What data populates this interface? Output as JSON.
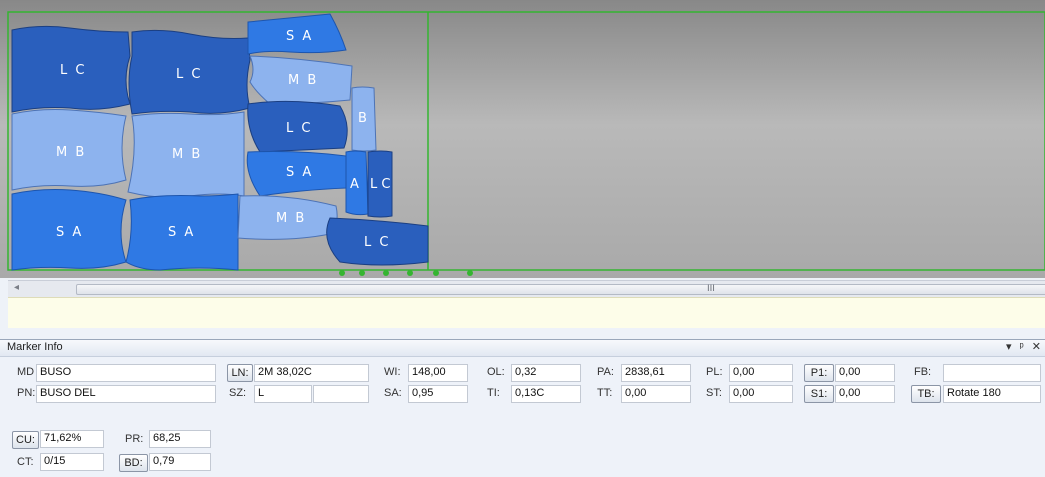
{
  "canvas": {
    "pieces": [
      {
        "label": "L C",
        "color": "#2a5fbd"
      },
      {
        "label": "L C",
        "color": "#2a5fbd"
      },
      {
        "label": "M B",
        "color": "#8db3ee"
      },
      {
        "label": "M B",
        "color": "#8db3ee"
      },
      {
        "label": "S A",
        "color": "#2f79e4"
      },
      {
        "label": "S A",
        "color": "#2f79e4"
      },
      {
        "label": "S A",
        "color": "#2f79e4"
      },
      {
        "label": "M B",
        "color": "#8db3ee"
      },
      {
        "label": "L C",
        "color": "#2a5fbd"
      },
      {
        "label": "S A",
        "color": "#2f79e4"
      },
      {
        "label": "M B",
        "color": "#8db3ee"
      },
      {
        "label": "L C",
        "color": "#2a5fbd"
      },
      {
        "label": "B",
        "color": "#8db3ee"
      },
      {
        "label": "A",
        "color": "#2f79e4"
      },
      {
        "label": "L C",
        "color": "#2a5fbd"
      }
    ],
    "marker_border_color": "#35b531"
  },
  "scrollbar": {
    "left_arrow": "◂",
    "grip": "III"
  },
  "panel": {
    "title": "Marker Info",
    "controls": {
      "dropdown": "▾",
      "pin": "ᵖ",
      "close": "✕"
    },
    "md": {
      "label": "MD",
      "value": "BUSO"
    },
    "pn": {
      "label": "PN:",
      "value": "BUSO DEL"
    },
    "ln": {
      "label": "LN:",
      "value": "2M 38,02C"
    },
    "sz": {
      "label": "SZ:",
      "value": "L",
      "value2": ""
    },
    "wi": {
      "label": "WI:",
      "value": "148,00"
    },
    "sa": {
      "label": "SA:",
      "value": "0,95"
    },
    "ol": {
      "label": "OL:",
      "value": "0,32"
    },
    "ti": {
      "label": "TI:",
      "value": "0,13C"
    },
    "pa": {
      "label": "PA:",
      "value": "2838,61"
    },
    "tt": {
      "label": "TT:",
      "value": "0,00"
    },
    "pl": {
      "label": "PL:",
      "value": "0,00"
    },
    "st": {
      "label": "ST:",
      "value": "0,00"
    },
    "p1": {
      "label": "P1:",
      "value": "0,00"
    },
    "s1": {
      "label": "S1:",
      "value": "0,00"
    },
    "fb": {
      "label": "FB:",
      "value": ""
    },
    "tb": {
      "label": "TB:",
      "value": "Rotate 180"
    },
    "cu": {
      "label": "CU:",
      "value": "71,62%"
    },
    "pr": {
      "label": "PR:",
      "value": "68,25"
    },
    "ct": {
      "label": "CT:",
      "value": "0/15"
    },
    "bd": {
      "label": "BD:",
      "value": "0,79"
    }
  }
}
